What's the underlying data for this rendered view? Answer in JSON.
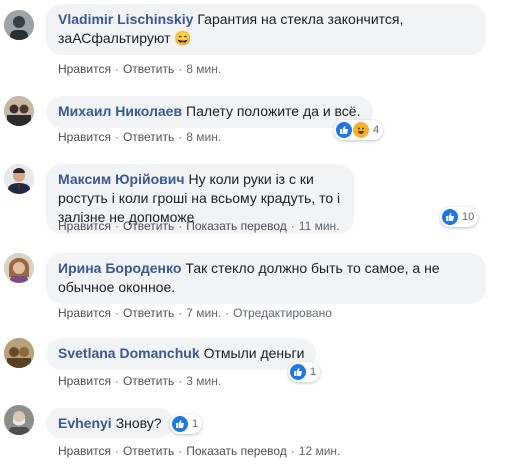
{
  "comments": [
    {
      "author": "Vladimir Lischinskiy",
      "text": "Гарантия на стекла закончится, заАСфальтируют 😄",
      "like": "Нравится",
      "reply": "Ответить",
      "time": "8 мин."
    },
    {
      "author": "Михаил Николаев",
      "text": "Палету положите да и всё.",
      "like": "Нравится",
      "reply": "Ответить",
      "time": "8 мин.",
      "reactions": {
        "count": "4",
        "types": [
          "like-icon",
          "haha-icon"
        ]
      }
    },
    {
      "author": "Максим Юрійович",
      "text": "Ну коли руки із с     ки ростуть і коли гроші на всьому крадуть, то і залізне не допоможе",
      "like": "Нравится",
      "reply": "Ответить",
      "translate": "Показать перевод",
      "time": "11 мин.",
      "reactions": {
        "count": "10",
        "types": [
          "like-icon"
        ]
      }
    },
    {
      "author": "Ирина Бороденко",
      "text": "Так стекло должно быть то самое, а не обычное оконное.",
      "like": "Нравится",
      "reply": "Ответить",
      "time": "7 мин.",
      "edited": "Отредактировано"
    },
    {
      "author": "Svetlana Domanchuk",
      "text": "Отмыли деньги",
      "like": "Нравится",
      "reply": "Ответить",
      "time": "3 мин.",
      "reactions": {
        "count": "1",
        "types": [
          "like-icon"
        ]
      }
    },
    {
      "author": "Evhenyi",
      "text": "Знову?",
      "like": "Нравится",
      "reply": "Ответить",
      "translate": "Показать перевод",
      "time": "12 мин.",
      "reactions": {
        "count": "1",
        "types": [
          "like-icon"
        ]
      }
    }
  ],
  "colors": {
    "link_blue": "#385898",
    "bubble_bg": "#f2f3f5",
    "like_blue": "#1877f2",
    "haha_yellow": "#f7b125",
    "meta_gray": "#606770"
  }
}
